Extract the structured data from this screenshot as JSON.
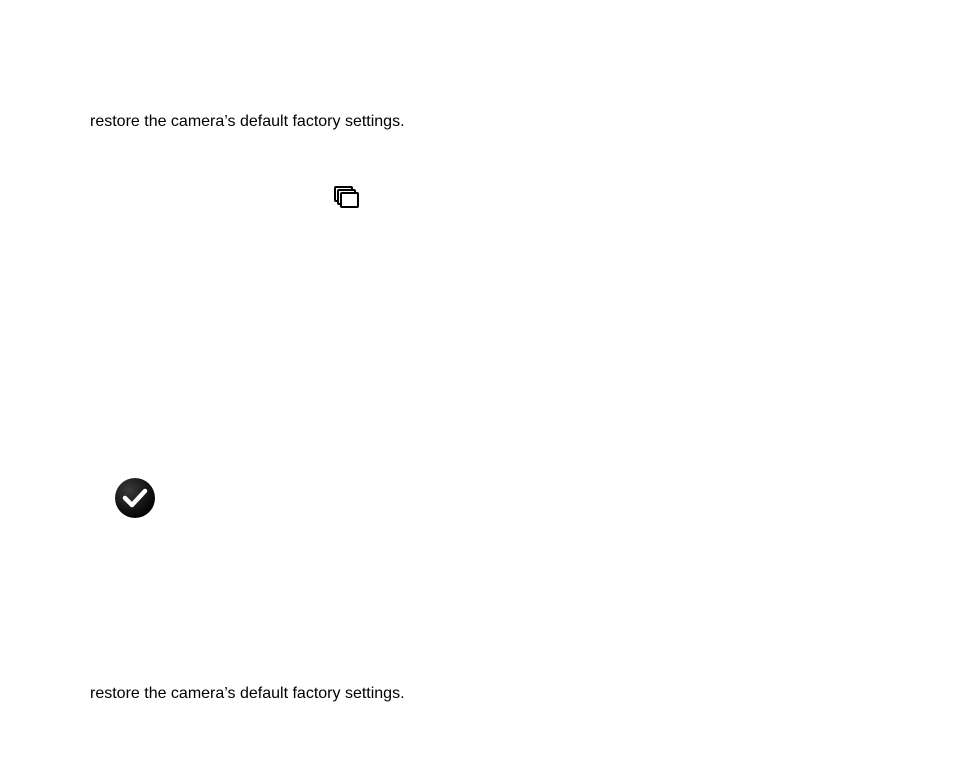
{
  "lines": {
    "top": "restore the camera’s default factory settings.",
    "bottom": "restore the camera’s default factory settings."
  }
}
